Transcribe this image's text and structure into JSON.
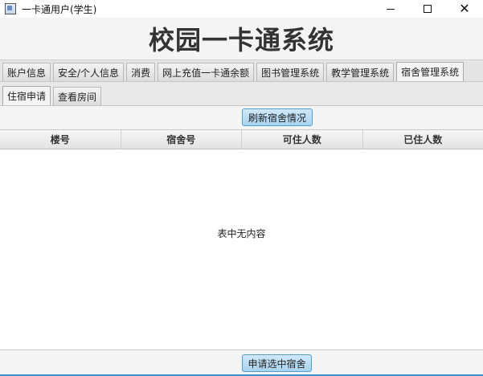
{
  "window": {
    "title": "一卡通用户(学生)",
    "icon": "app-window-icon",
    "controls": {
      "minimize": "minimize-icon",
      "maximize": "maximize-icon",
      "close": "✕"
    }
  },
  "header": {
    "title": "校园一卡通系统"
  },
  "main_tabs": [
    {
      "label": "账户信息"
    },
    {
      "label": "安全/个人信息"
    },
    {
      "label": "消费"
    },
    {
      "label": "网上充值一卡通余额"
    },
    {
      "label": "图书管理系统"
    },
    {
      "label": "教学管理系统"
    },
    {
      "label": "宿舍管理系统",
      "selected": true
    }
  ],
  "sub_tabs": [
    {
      "label": "住宿申请",
      "selected": true
    },
    {
      "label": "查看房间"
    }
  ],
  "content": {
    "refresh_button": "刷新宿舍情况",
    "apply_button": "申请选中宿舍",
    "table": {
      "columns": [
        "楼号",
        "宿舍号",
        "可住人数",
        "已住人数"
      ],
      "rows": [],
      "placeholder": "表中无内容"
    }
  },
  "colors": {
    "accent_button": "#a8d3f0",
    "accent_border": "#4f9fd6",
    "bottom_line": "#3c8fc7"
  }
}
